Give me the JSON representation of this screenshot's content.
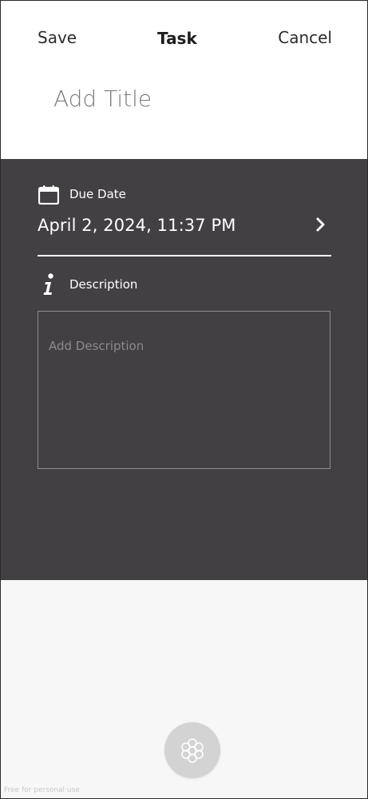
{
  "header": {
    "save_label": "Save",
    "title": "Task",
    "cancel_label": "Cancel"
  },
  "title_field": {
    "placeholder": "Add Title",
    "value": ""
  },
  "due_date": {
    "label": "Due Date",
    "value": "April 2, 2024, 11:37 PM",
    "icon": "calendar-icon",
    "chevron_icon": "chevron-right-icon"
  },
  "description": {
    "label": "Description",
    "icon": "info-icon",
    "placeholder": "Add Description",
    "value": ""
  },
  "fab": {
    "icon": "flower-icon"
  },
  "watermark": {
    "text": "Free for personal use"
  },
  "colors": {
    "header_bg": "#ffffff",
    "panel_bg": "#434043",
    "bottom_bg": "#f7f7f7",
    "fab_bg": "#d3d3d3",
    "text_dark": "#1d1d1d",
    "text_light": "#ffffff",
    "placeholder_on_dark": "#8d8a8d"
  }
}
